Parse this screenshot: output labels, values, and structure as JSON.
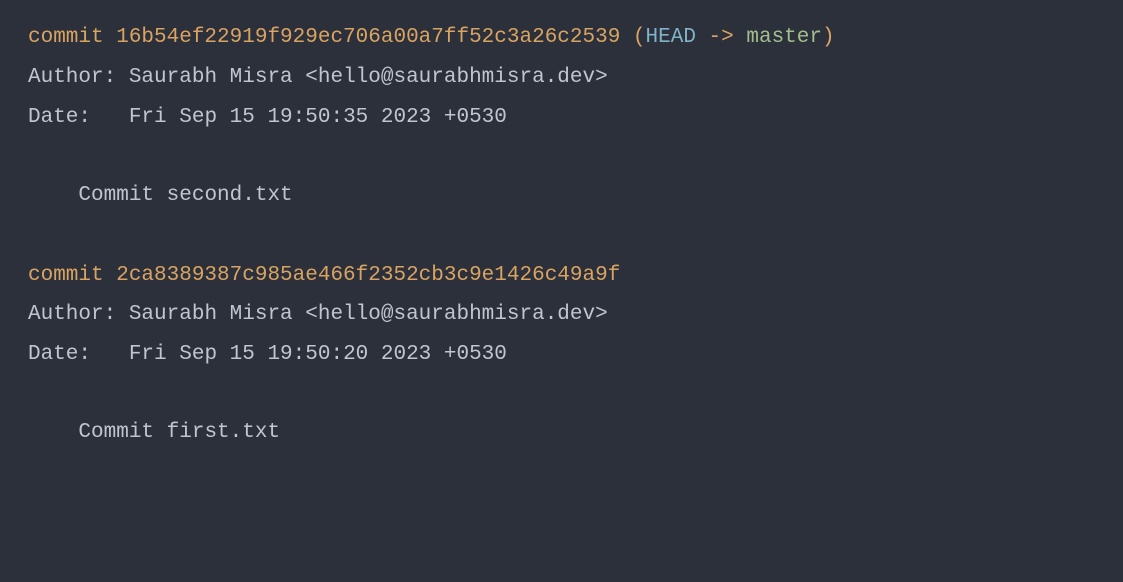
{
  "commits": [
    {
      "commit_label": "commit ",
      "hash": "16b54ef22919f929ec706a00a7ff52c3a26c2539",
      "refs": {
        "open_paren": " (",
        "head": "HEAD",
        "arrow": " -> ",
        "branch": "master",
        "close_paren": ")"
      },
      "author_label": "Author: ",
      "author_value": "Saurabh Misra <hello@saurabhmisra.dev>",
      "date_label": "Date:   ",
      "date_value": "Fri Sep 15 19:50:35 2023 +0530",
      "message_prefix": "    ",
      "message": "Commit second.txt"
    },
    {
      "commit_label": "commit ",
      "hash": "2ca8389387c985ae466f2352cb3c9e1426c49a9f",
      "author_label": "Author: ",
      "author_value": "Saurabh Misra <hello@saurabhmisra.dev>",
      "date_label": "Date:   ",
      "date_value": "Fri Sep 15 19:50:20 2023 +0530",
      "message_prefix": "    ",
      "message": "Commit first.txt"
    }
  ]
}
